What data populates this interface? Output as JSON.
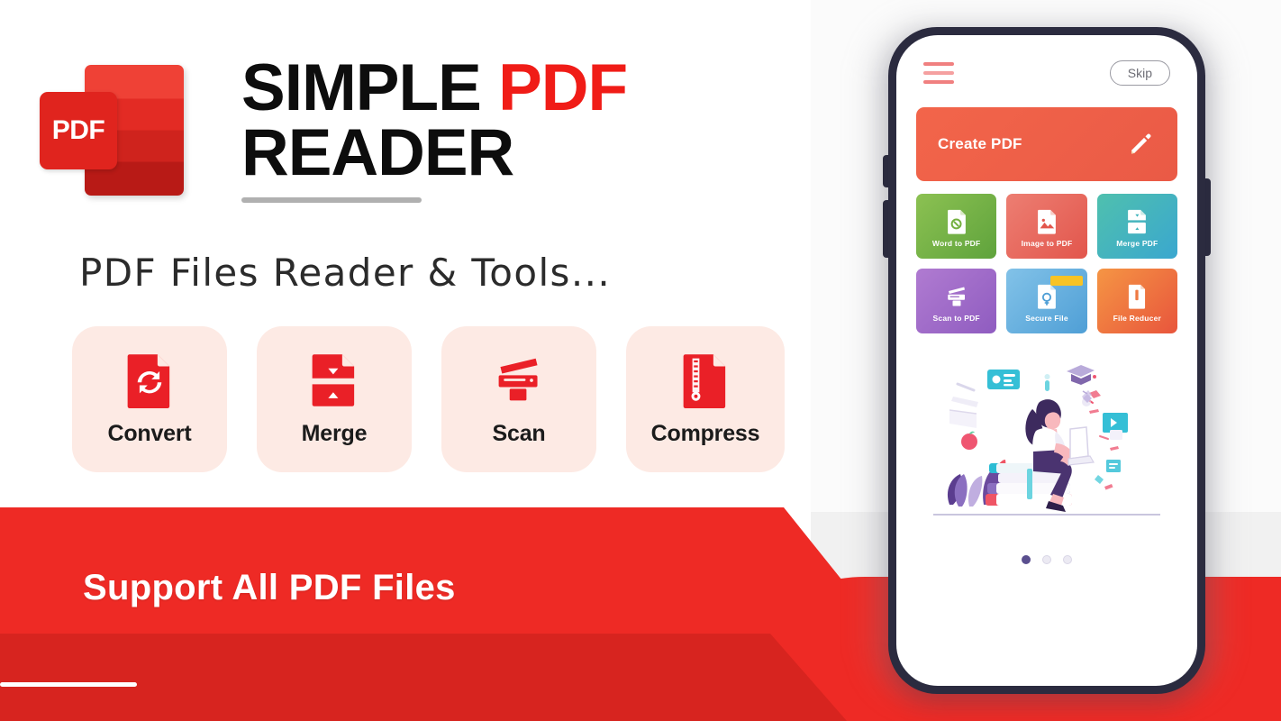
{
  "brand": {
    "logo_text": "PDF",
    "title_line1_black": "SIMPLE",
    "title_line1_red": "PDF",
    "title_line2": "READER",
    "subtitle": "PDF Files Reader & Tools...",
    "accent_red": "#ee2a25",
    "accent_black": "#0d0d0d"
  },
  "features": [
    {
      "label": "Convert",
      "icon": "convert-document-icon"
    },
    {
      "label": "Merge",
      "icon": "merge-document-icon"
    },
    {
      "label": "Scan",
      "icon": "scanner-icon"
    },
    {
      "label": "Compress",
      "icon": "compress-zipper-document-icon"
    }
  ],
  "banner": {
    "text": "Support All PDF Files",
    "bg_color": "#ee2a25",
    "text_color": "#ffffff"
  },
  "phone": {
    "header": {
      "menu_icon": "hamburger-menu-icon",
      "skip_label": "Skip"
    },
    "create_card": {
      "label": "Create PDF",
      "icon": "pencil-edit-icon",
      "bg_color": "#ea5a46"
    },
    "tiles": [
      {
        "label": "Word to PDF",
        "icon": "word-document-icon",
        "color_from": "#8cc152",
        "color_to": "#5fa33c"
      },
      {
        "label": "Image to PDF",
        "icon": "image-document-icon",
        "color_from": "#ed7e72",
        "color_to": "#e2564c",
        "badge": false
      },
      {
        "label": "Merge PDF",
        "icon": "merge-pdf-icon",
        "color_from": "#4fc0ae",
        "color_to": "#3aa7cf"
      },
      {
        "label": "Scan to PDF",
        "icon": "scan-printer-icon",
        "color_from": "#b07bd1",
        "color_to": "#8f5cc0"
      },
      {
        "label": "Secure File",
        "icon": "secure-lock-file-icon",
        "color_from": "#82c2e8",
        "color_to": "#4f9fd6",
        "badge": true
      },
      {
        "label": "File Reducer",
        "icon": "file-reducer-icon",
        "color_from": "#f59544",
        "color_to": "#e8553c"
      }
    ],
    "illustration": "woman-studying-on-books-with-laptop-illustration",
    "pagination": {
      "total": 3,
      "active_index": 0
    }
  }
}
